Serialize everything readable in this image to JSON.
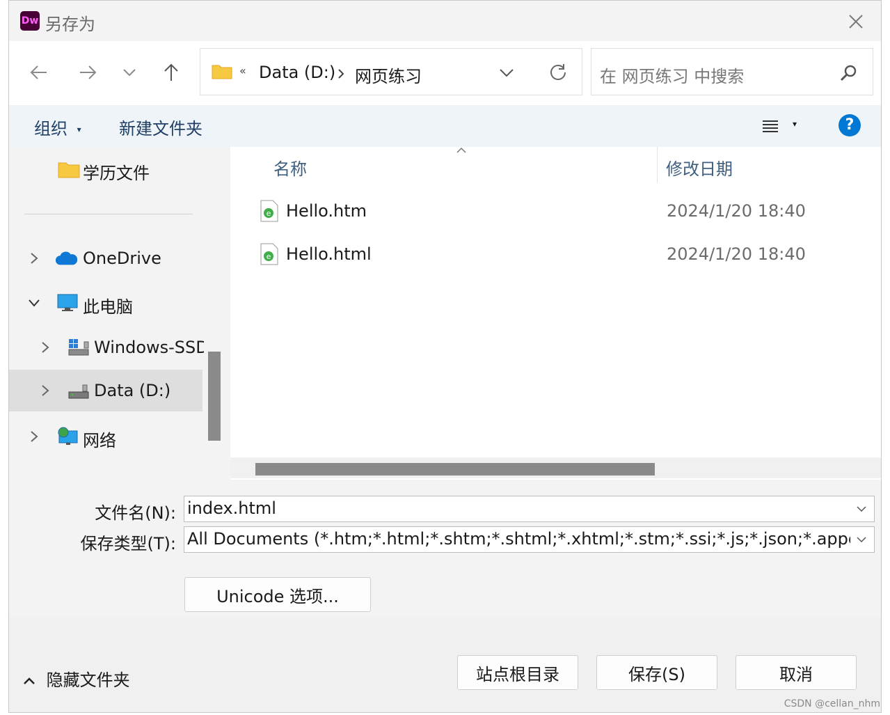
{
  "window": {
    "app_icon_text": "Dw",
    "title": "另存为"
  },
  "address_bar": {
    "overflow_marker": "«",
    "breadcrumbs": [
      "Data (D:)",
      "网页练习"
    ]
  },
  "search": {
    "placeholder": "在 网页练习 中搜索"
  },
  "toolbar": {
    "organize_label": "组织",
    "new_folder_label": "新建文件夹"
  },
  "nav_tree": {
    "items": [
      {
        "label": "学历文件"
      },
      {
        "label": "OneDrive"
      },
      {
        "label": "此电脑"
      },
      {
        "label": "Windows-SSD"
      },
      {
        "label": "Data (D:)"
      },
      {
        "label": "网络"
      }
    ]
  },
  "file_list": {
    "columns": [
      "名称",
      "修改日期"
    ],
    "rows": [
      {
        "name": "Hello.htm",
        "modified": "2024/1/20 18:40"
      },
      {
        "name": "Hello.html",
        "modified": "2024/1/20 18:40"
      }
    ]
  },
  "form": {
    "filename_label": "文件名(N):",
    "filename_value": "index.html",
    "filetype_label": "保存类型(T):",
    "filetype_value": "All Documents (*.htm;*.html;*.shtm;*.shtml;*.xhtml;*.stm;*.ssi;*.js;*.json;*.appcache;*.",
    "unicode_button": "Unicode 选项..."
  },
  "footer": {
    "hide_folders_label": "隐藏文件夹",
    "site_root_button": "站点根目录",
    "save_button": "保存(S)",
    "cancel_button": "取消"
  },
  "watermark": "CSDN @cellan_nhm",
  "colors": {
    "accent": "#0078d4",
    "folder": "#f7c842",
    "onedrive": "#0f78d4",
    "scroll_thumb": "#8a8a8a",
    "toolbar_bg": "#eff4f9"
  }
}
